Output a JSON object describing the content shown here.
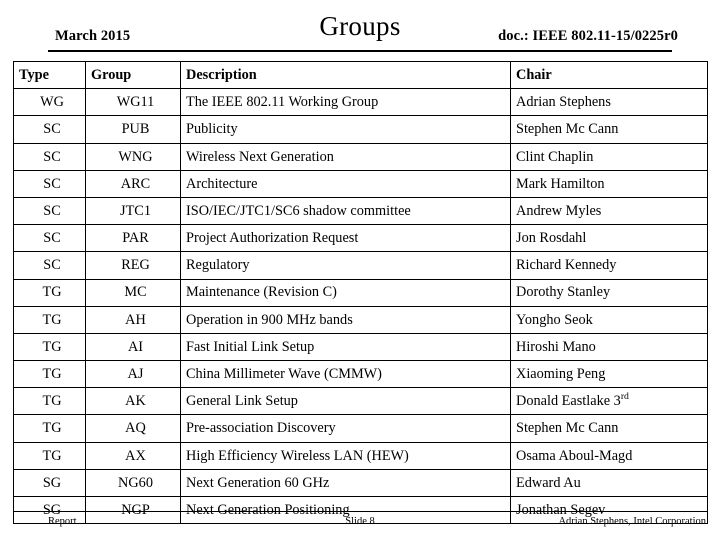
{
  "header": {
    "date": "March 2015",
    "title": "Groups",
    "doc_reference": "doc.: IEEE 802.11-15/0225r0"
  },
  "table": {
    "columns": [
      "Type",
      "Group",
      "Description",
      "Chair"
    ],
    "rows": [
      {
        "type": "WG",
        "group": "WG11",
        "description": "The IEEE 802.11 Working Group",
        "chair": "Adrian Stephens"
      },
      {
        "type": "SC",
        "group": "PUB",
        "description": "Publicity",
        "chair": "Stephen Mc Cann"
      },
      {
        "type": "SC",
        "group": "WNG",
        "description": "Wireless Next Generation",
        "chair": "Clint Chaplin"
      },
      {
        "type": "SC",
        "group": "ARC",
        "description": "Architecture",
        "chair": "Mark Hamilton"
      },
      {
        "type": "SC",
        "group": "JTC1",
        "description": "ISO/IEC/JTC1/SC6 shadow committee",
        "chair": "Andrew Myles"
      },
      {
        "type": "SC",
        "group": "PAR",
        "description": "Project Authorization Request",
        "chair": "Jon Rosdahl"
      },
      {
        "type": "SC",
        "group": "REG",
        "description": "Regulatory",
        "chair": "Richard Kennedy"
      },
      {
        "type": "TG",
        "group": "MC",
        "description": "Maintenance (Revision C)",
        "chair": "Dorothy Stanley"
      },
      {
        "type": "TG",
        "group": "AH",
        "description": "Operation in 900 MHz bands",
        "chair": "Yongho Seok"
      },
      {
        "type": "TG",
        "group": "AI",
        "description": "Fast Initial Link Setup",
        "chair": "Hiroshi Mano"
      },
      {
        "type": "TG",
        "group": "AJ",
        "description": "China Millimeter Wave (CMMW)",
        "chair": "Xiaoming Peng"
      },
      {
        "type": "TG",
        "group": "AK",
        "description": "General Link Setup",
        "chair": "Donald Eastlake 3",
        "chair_sup": "rd"
      },
      {
        "type": "TG",
        "group": "AQ",
        "description": "Pre-association Discovery",
        "chair": "Stephen Mc Cann"
      },
      {
        "type": "TG",
        "group": "AX",
        "description": "High Efficiency Wireless LAN (HEW)",
        "chair": "Osama Aboul-Magd"
      },
      {
        "type": "SG",
        "group": "NG60",
        "description": "Next Generation 60 GHz",
        "chair": "Edward Au"
      },
      {
        "type": "SG",
        "group": "NGP",
        "description": "Next Generation Positioning",
        "chair": "Jonathan Segev"
      }
    ]
  },
  "footer": {
    "left": "Report",
    "center": "Slide 8",
    "right": "Adrian Stephens, Intel Corporation"
  },
  "colors": {
    "text": "#000000",
    "background": "#ffffff",
    "border": "#000000"
  }
}
